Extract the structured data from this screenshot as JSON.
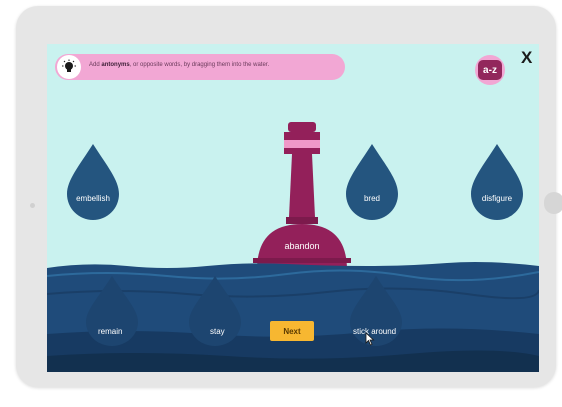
{
  "instruction": {
    "prefix": "Add",
    "keyword": "antonyms",
    "suffix": ", or opposite words, by dragging them into the water."
  },
  "header": {
    "az_label": "a-z",
    "close_label": "X"
  },
  "buoy_word": "abandon",
  "sky_words": [
    "embellish",
    "bred",
    "disfigure"
  ],
  "water_words": [
    "remain",
    "stay",
    "stick around"
  ],
  "next_label": "Next",
  "colors": {
    "sky": "#c9f2ef",
    "water": "#1f4b7a",
    "drop": "#24557f",
    "buoy": "#93205a",
    "banner": "#f2a7d4",
    "button": "#f7b731"
  }
}
